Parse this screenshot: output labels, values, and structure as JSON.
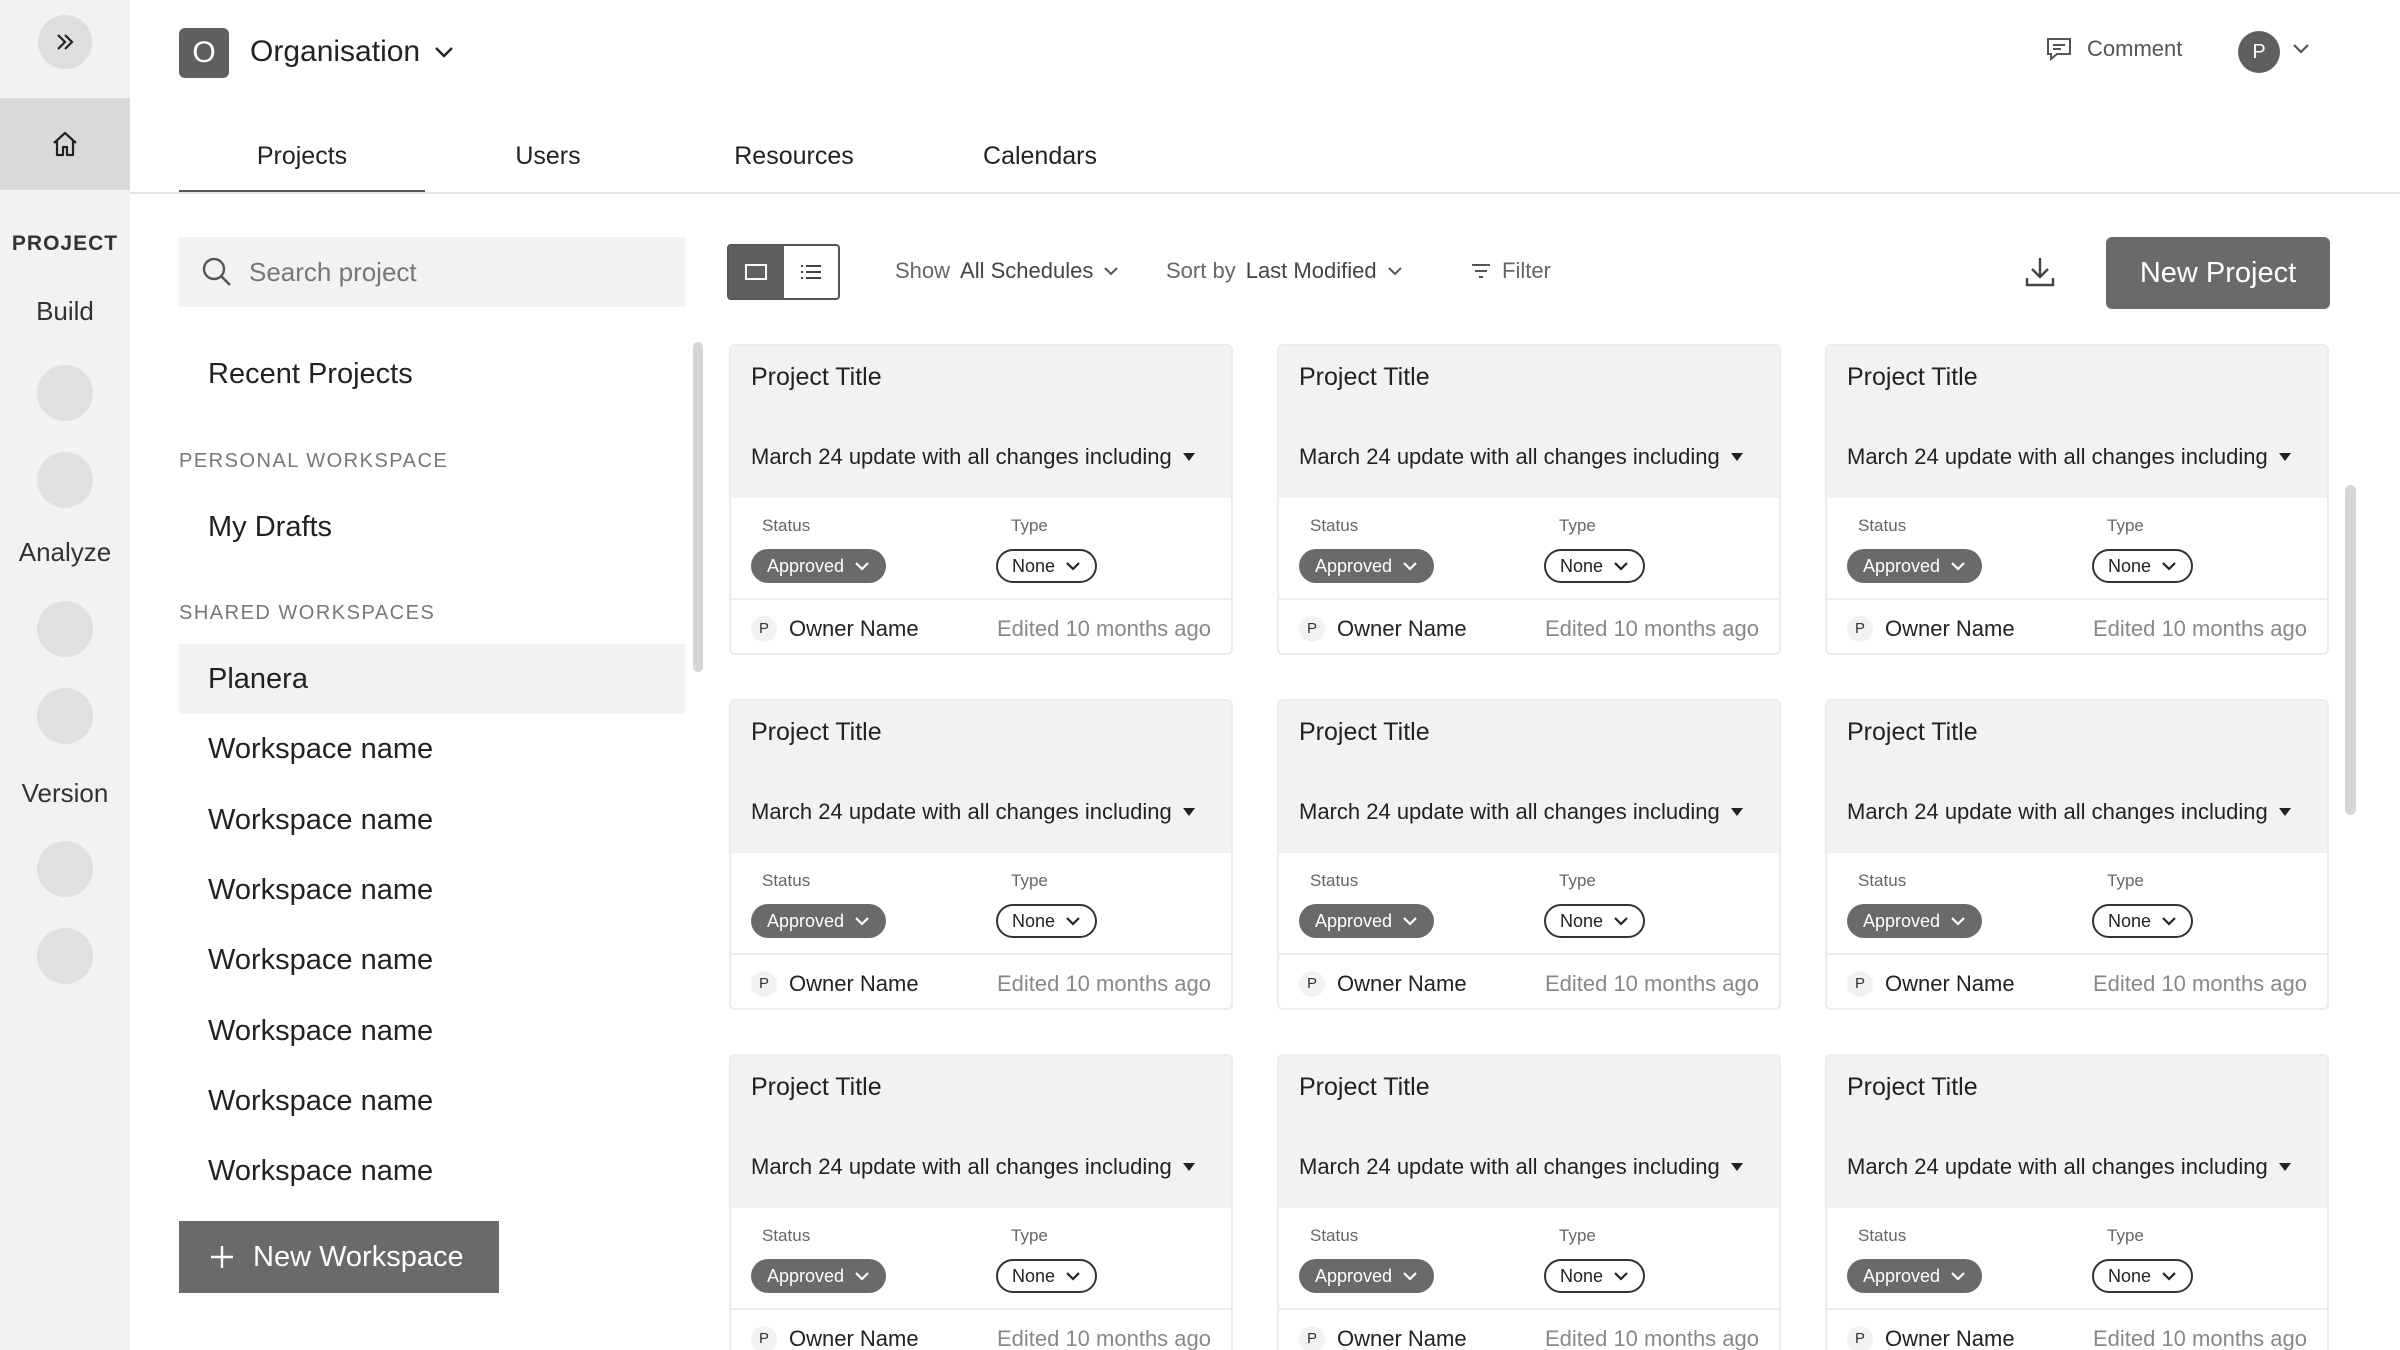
{
  "rail": {
    "section": "PROJECT",
    "labels": [
      "Build",
      "Analyze",
      "Version"
    ]
  },
  "header": {
    "org_badge": "O",
    "org_name": "Organisation",
    "comment": "Comment",
    "avatar": "P"
  },
  "tabs": [
    "Projects",
    "Users",
    "Resources",
    "Calendars"
  ],
  "sidebar": {
    "search_placeholder": "Search project",
    "recent": "Recent Projects",
    "personal_heading": "PERSONAL WORKSPACE",
    "my_drafts": "My Drafts",
    "shared_heading": "SHARED WORKSPACES",
    "workspaces": [
      "Planera",
      "Workspace name",
      "Workspace name",
      "Workspace name",
      "Workspace name",
      "Workspace name",
      "Workspace name",
      "Workspace name"
    ],
    "new_workspace": "New Workspace"
  },
  "toolbar": {
    "show_label": "Show",
    "show_value": "All Schedules",
    "sort_label": "Sort by",
    "sort_value": "Last Modified",
    "filter": "Filter",
    "new_project": "New Project"
  },
  "cards": [
    {
      "title": "Project Title",
      "update": "March 24 update with all changes including",
      "status_label": "Status",
      "status": "Approved",
      "type_label": "Type",
      "type": "None",
      "owner_initial": "P",
      "owner": "Owner Name",
      "edited": "Edited 10 months ago"
    },
    {
      "title": "Project Title",
      "update": "March 24 update with all changes including",
      "status_label": "Status",
      "status": "Approved",
      "type_label": "Type",
      "type": "None",
      "owner_initial": "P",
      "owner": "Owner Name",
      "edited": "Edited 10 months ago"
    },
    {
      "title": "Project Title",
      "update": "March 24 update with all changes including",
      "status_label": "Status",
      "status": "Approved",
      "type_label": "Type",
      "type": "None",
      "owner_initial": "P",
      "owner": "Owner Name",
      "edited": "Edited 10 months ago"
    },
    {
      "title": "Project Title",
      "update": "March 24 update with all changes including",
      "status_label": "Status",
      "status": "Approved",
      "type_label": "Type",
      "type": "None",
      "owner_initial": "P",
      "owner": "Owner Name",
      "edited": "Edited 10 months ago"
    },
    {
      "title": "Project Title",
      "update": "March 24 update with all changes including",
      "status_label": "Status",
      "status": "Approved",
      "type_label": "Type",
      "type": "None",
      "owner_initial": "P",
      "owner": "Owner Name",
      "edited": "Edited 10 months ago"
    },
    {
      "title": "Project Title",
      "update": "March 24 update with all changes including",
      "status_label": "Status",
      "status": "Approved",
      "type_label": "Type",
      "type": "None",
      "owner_initial": "P",
      "owner": "Owner Name",
      "edited": "Edited 10 months ago"
    },
    {
      "title": "Project Title",
      "update": "March 24 update with all changes including",
      "status_label": "Status",
      "status": "Approved",
      "type_label": "Type",
      "type": "None",
      "owner_initial": "P",
      "owner": "Owner Name",
      "edited": "Edited 10 months ago"
    },
    {
      "title": "Project Title",
      "update": "March 24 update with all changes including",
      "status_label": "Status",
      "status": "Approved",
      "type_label": "Type",
      "type": "None",
      "owner_initial": "P",
      "owner": "Owner Name",
      "edited": "Edited 10 months ago"
    },
    {
      "title": "Project Title",
      "update": "March 24 update with all changes including",
      "status_label": "Status",
      "status": "Approved",
      "type_label": "Type",
      "type": "None",
      "owner_initial": "P",
      "owner": "Owner Name",
      "edited": "Edited 10 months ago"
    }
  ],
  "colors": {
    "accent_dark": "#5f5f5f",
    "button_fill": "#6a6a6a",
    "panel_gray": "#f2f2f2"
  },
  "icons": [
    "double-chevron-right-icon",
    "home-icon",
    "chevron-down-icon",
    "comment-icon",
    "search-icon",
    "grid-view-icon",
    "list-view-icon",
    "filter-icon",
    "download-icon",
    "plus-icon",
    "caret-down-icon"
  ]
}
